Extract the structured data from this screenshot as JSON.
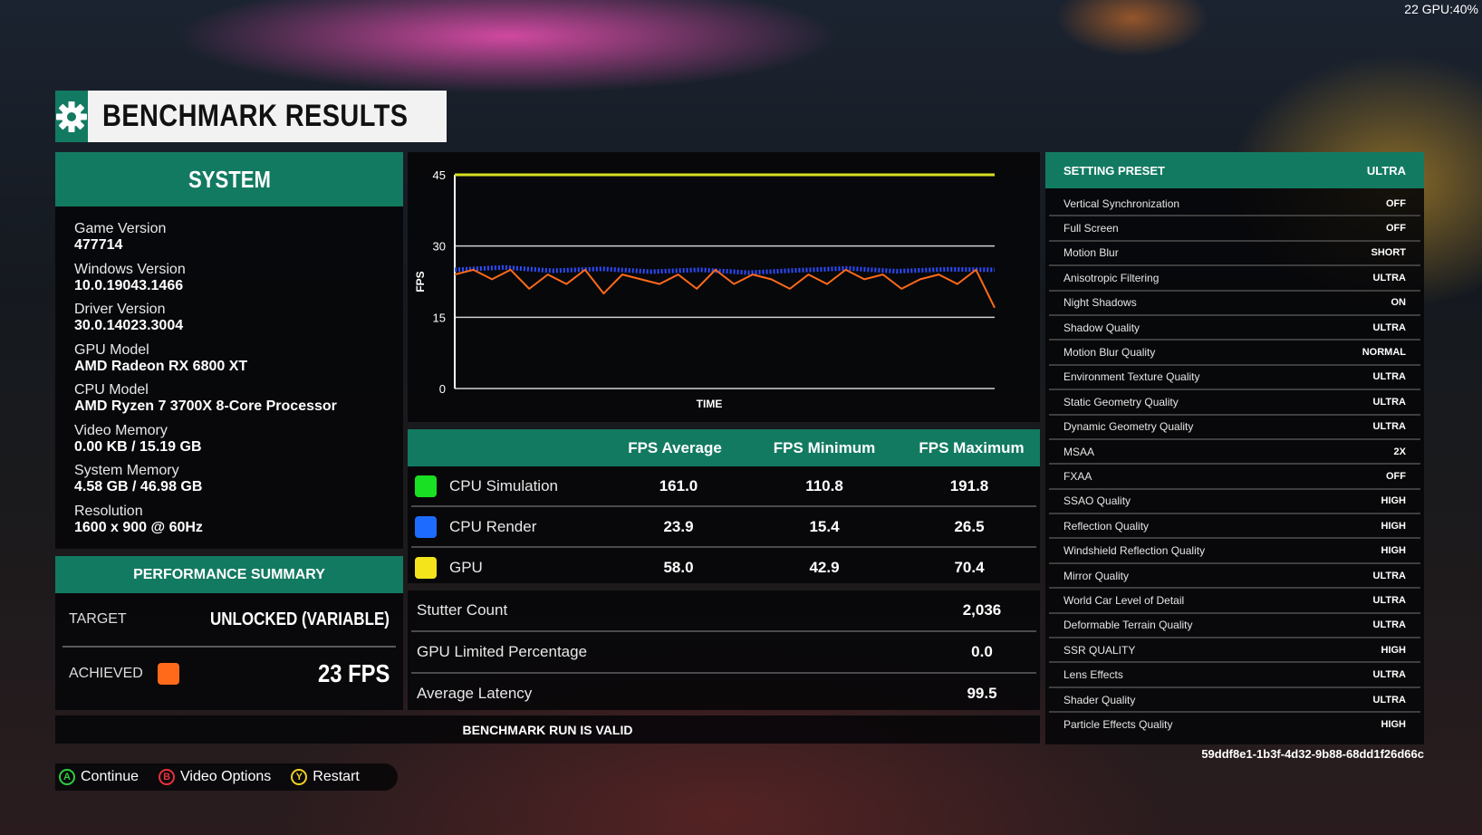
{
  "overlay": {
    "text": "22 GPU:40%"
  },
  "title": {
    "text": "BENCHMARK RESULTS",
    "icon": "gear-icon"
  },
  "system": {
    "header": "SYSTEM",
    "items": [
      {
        "label": "Game Version",
        "value": "477714"
      },
      {
        "label": "Windows Version",
        "value": "10.0.19043.1466"
      },
      {
        "label": "Driver Version",
        "value": "30.0.14023.3004"
      },
      {
        "label": "GPU Model",
        "value": "AMD Radeon RX 6800 XT"
      },
      {
        "label": "CPU Model",
        "value": "AMD Ryzen 7 3700X 8-Core Processor"
      },
      {
        "label": "Video Memory",
        "value": "0.00 KB / 15.19 GB"
      },
      {
        "label": "System Memory",
        "value": "4.58 GB / 46.98 GB"
      },
      {
        "label": "Resolution",
        "value": "1600 x 900 @ 60Hz"
      }
    ]
  },
  "performance_summary": {
    "header": "PERFORMANCE SUMMARY",
    "target_label": "TARGET",
    "target_value": "UNLOCKED (VARIABLE)",
    "achieved_label": "ACHIEVED",
    "achieved_value": "23 FPS",
    "achieved_color": "#ff6a1a"
  },
  "chart_data": {
    "type": "line",
    "ylabel": "FPS",
    "xlabel": "TIME",
    "ylim": [
      0,
      45
    ],
    "yticks": [
      0,
      15,
      30,
      45
    ],
    "grid": true,
    "series": [
      {
        "name": "GPU",
        "color": "#d8e020",
        "style": "line",
        "values": [
          45,
          45,
          45,
          45,
          45,
          45,
          45,
          45,
          45,
          45,
          45,
          45
        ]
      },
      {
        "name": "CPU Render",
        "color": "#2e4bff",
        "style": "points",
        "values": [
          25,
          25.5,
          24.8,
          25.2,
          24.6,
          25,
          24.4,
          24.9,
          25.3,
          24.7,
          25.1,
          25
        ]
      },
      {
        "name": "Achieved",
        "color": "#ff6a1a",
        "style": "line",
        "values": [
          24,
          25,
          23,
          25,
          21,
          24,
          22,
          25,
          20,
          24,
          23,
          22,
          24,
          21,
          25,
          22,
          24,
          23,
          21,
          24,
          22,
          25,
          23,
          24,
          21,
          23,
          24,
          22,
          25,
          17
        ]
      }
    ]
  },
  "table": {
    "headers": [
      "FPS Average",
      "FPS Minimum",
      "FPS Maximum"
    ],
    "rows": [
      {
        "name": "CPU Simulation",
        "color": "#19e023",
        "avg": "161.0",
        "min": "110.8",
        "max": "191.8"
      },
      {
        "name": "CPU Render",
        "color": "#1e6cff",
        "avg": "23.9",
        "min": "15.4",
        "max": "26.5"
      },
      {
        "name": "GPU",
        "color": "#f4e41c",
        "avg": "58.0",
        "min": "42.9",
        "max": "70.4"
      }
    ]
  },
  "stats": [
    {
      "label": "Stutter Count",
      "value": "2,036"
    },
    {
      "label": "GPU Limited Percentage",
      "value": "0.0"
    },
    {
      "label": "Average Latency",
      "value": "99.5"
    }
  ],
  "valid_text": "BENCHMARK RUN IS VALID",
  "settings": {
    "preset_label": "SETTING PRESET",
    "preset_value": "ULTRA",
    "items": [
      {
        "label": "Vertical Synchronization",
        "value": "OFF"
      },
      {
        "label": "Full Screen",
        "value": "OFF"
      },
      {
        "label": "Motion Blur",
        "value": "SHORT"
      },
      {
        "label": "Anisotropic Filtering",
        "value": "ULTRA"
      },
      {
        "label": "Night Shadows",
        "value": "ON"
      },
      {
        "label": "Shadow Quality",
        "value": "ULTRA"
      },
      {
        "label": "Motion Blur Quality",
        "value": "NORMAL"
      },
      {
        "label": "Environment Texture Quality",
        "value": "ULTRA"
      },
      {
        "label": "Static Geometry Quality",
        "value": "ULTRA"
      },
      {
        "label": "Dynamic Geometry Quality",
        "value": "ULTRA"
      },
      {
        "label": "MSAA",
        "value": "2X"
      },
      {
        "label": "FXAA",
        "value": "OFF"
      },
      {
        "label": "SSAO Quality",
        "value": "HIGH"
      },
      {
        "label": "Reflection Quality",
        "value": "HIGH"
      },
      {
        "label": "Windshield Reflection Quality",
        "value": "HIGH"
      },
      {
        "label": "Mirror Quality",
        "value": "ULTRA"
      },
      {
        "label": "World Car Level of Detail",
        "value": "ULTRA"
      },
      {
        "label": "Deformable Terrain Quality",
        "value": "ULTRA"
      },
      {
        "label": "SSR QUALITY",
        "value": "HIGH"
      },
      {
        "label": "Lens Effects",
        "value": "ULTRA"
      },
      {
        "label": "Shader Quality",
        "value": "ULTRA"
      },
      {
        "label": "Particle Effects Quality",
        "value": "HIGH"
      }
    ]
  },
  "guid": "59ddf8e1-1b3f-4d32-9b88-68dd1f26d66c",
  "controls": [
    {
      "key": "A",
      "label": "Continue",
      "color": "#2ecc40"
    },
    {
      "key": "B",
      "label": "Video Options",
      "color": "#e8323c"
    },
    {
      "key": "Y",
      "label": "Restart",
      "color": "#f0d020"
    }
  ]
}
